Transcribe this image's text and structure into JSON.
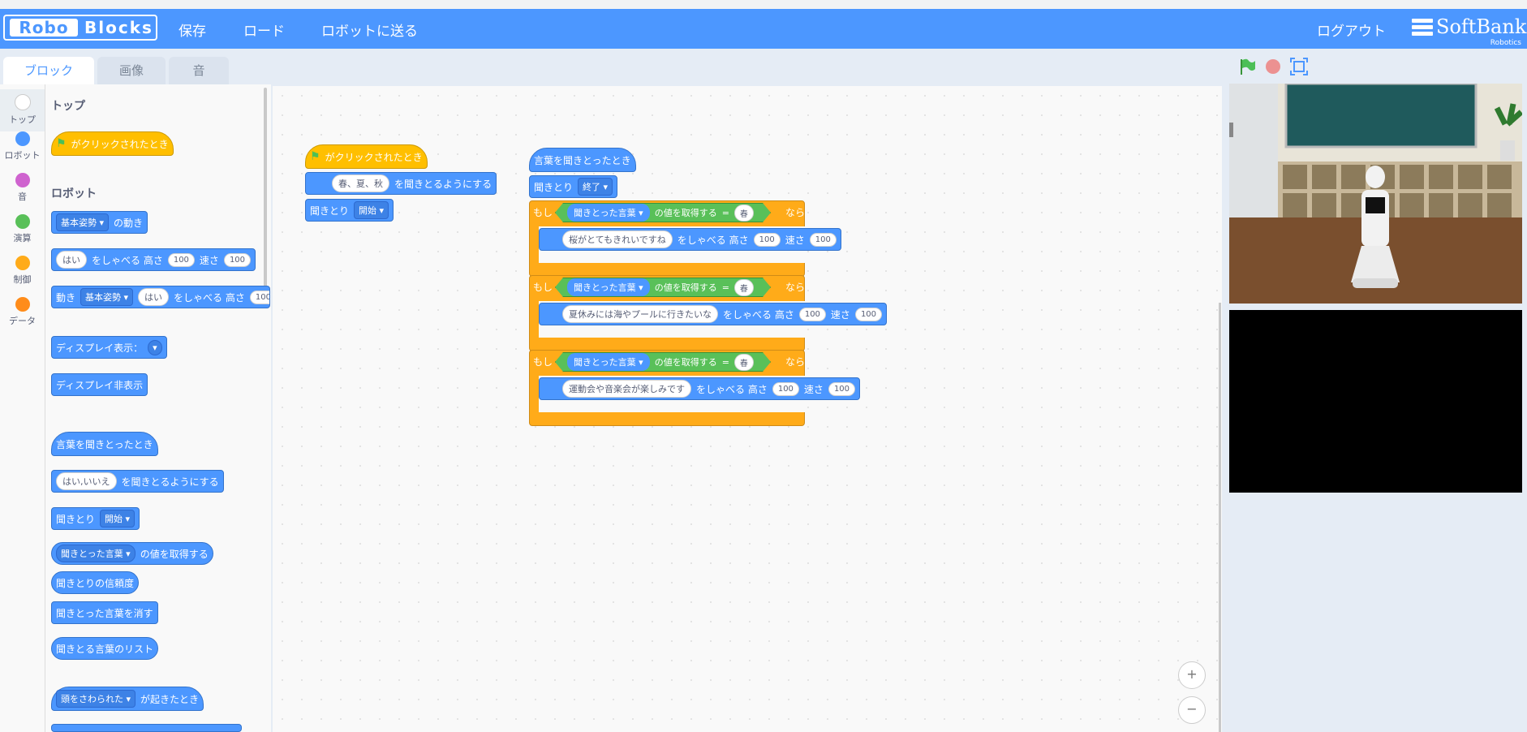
{
  "header": {
    "logo_part1": "Robo",
    "logo_part2": "Blocks",
    "menu": [
      "保存",
      "ロード",
      "ロボットに送る"
    ],
    "logout": "ログアウト",
    "brand": "SoftBank",
    "brand_sub": "Robotics"
  },
  "tabs": [
    "ブロック",
    "画像",
    "音"
  ],
  "categories": [
    {
      "label": "トップ",
      "color": "#ffffff"
    },
    {
      "label": "ロボット",
      "color": "#4c97ff"
    },
    {
      "label": "音",
      "color": "#cf63cf"
    },
    {
      "label": "演算",
      "color": "#59c059"
    },
    {
      "label": "制御",
      "color": "#ffab19"
    },
    {
      "label": "データ",
      "color": "#ff8c1a"
    }
  ],
  "palette": {
    "section_top": "トップ",
    "section_robot": "ロボット",
    "when_flag": "がクリックされたとき",
    "motion_dd": "基本姿勢",
    "motion_text": "の動き",
    "say_val": "はい",
    "say_text": "をしゃべる 高さ",
    "say_speed": "速さ",
    "num100": "100",
    "move_label": "動き",
    "display_show": "ディスプレイ表示：",
    "display_hide": "ディスプレイ非表示",
    "when_hear": "言葉を聞きとったとき",
    "hear_val": "はい,いいえ",
    "hear_text": "を聞きとるようにする",
    "listen": "聞きとり",
    "listen_start": "開始",
    "heard_word": "聞きとった言葉",
    "get_value": "の値を取得する",
    "confidence": "聞きとりの信頼度",
    "clear_word": "聞きとった言葉を消す",
    "word_list": "聞きとる言葉のリスト",
    "head_touched": "頭をさわられた",
    "when_happened": "が起きたとき"
  },
  "script1": {
    "hat": "がクリックされたとき",
    "words": "春、夏、秋",
    "words_text": "を聞きとるようにする",
    "listen": "聞きとり",
    "listen_dd": "開始"
  },
  "script2": {
    "hat": "言葉を聞きとったとき",
    "listen": "聞きとり",
    "listen_dd": "終了",
    "if_label": "もし",
    "then_label": "なら",
    "cond_dd": "聞きとった言葉",
    "cond_text": "の値を取得する",
    "eq": "=",
    "cond_val": "春",
    "say_text": "をしゃべる 高さ",
    "speed": "速さ",
    "num100": "100",
    "say1": "桜がとてもきれいですね",
    "say2": "夏休みには海やプールに行きたいな",
    "say3": "運動会や音楽会が楽しみです"
  },
  "zoom": {
    "in": "+",
    "out": "−"
  }
}
